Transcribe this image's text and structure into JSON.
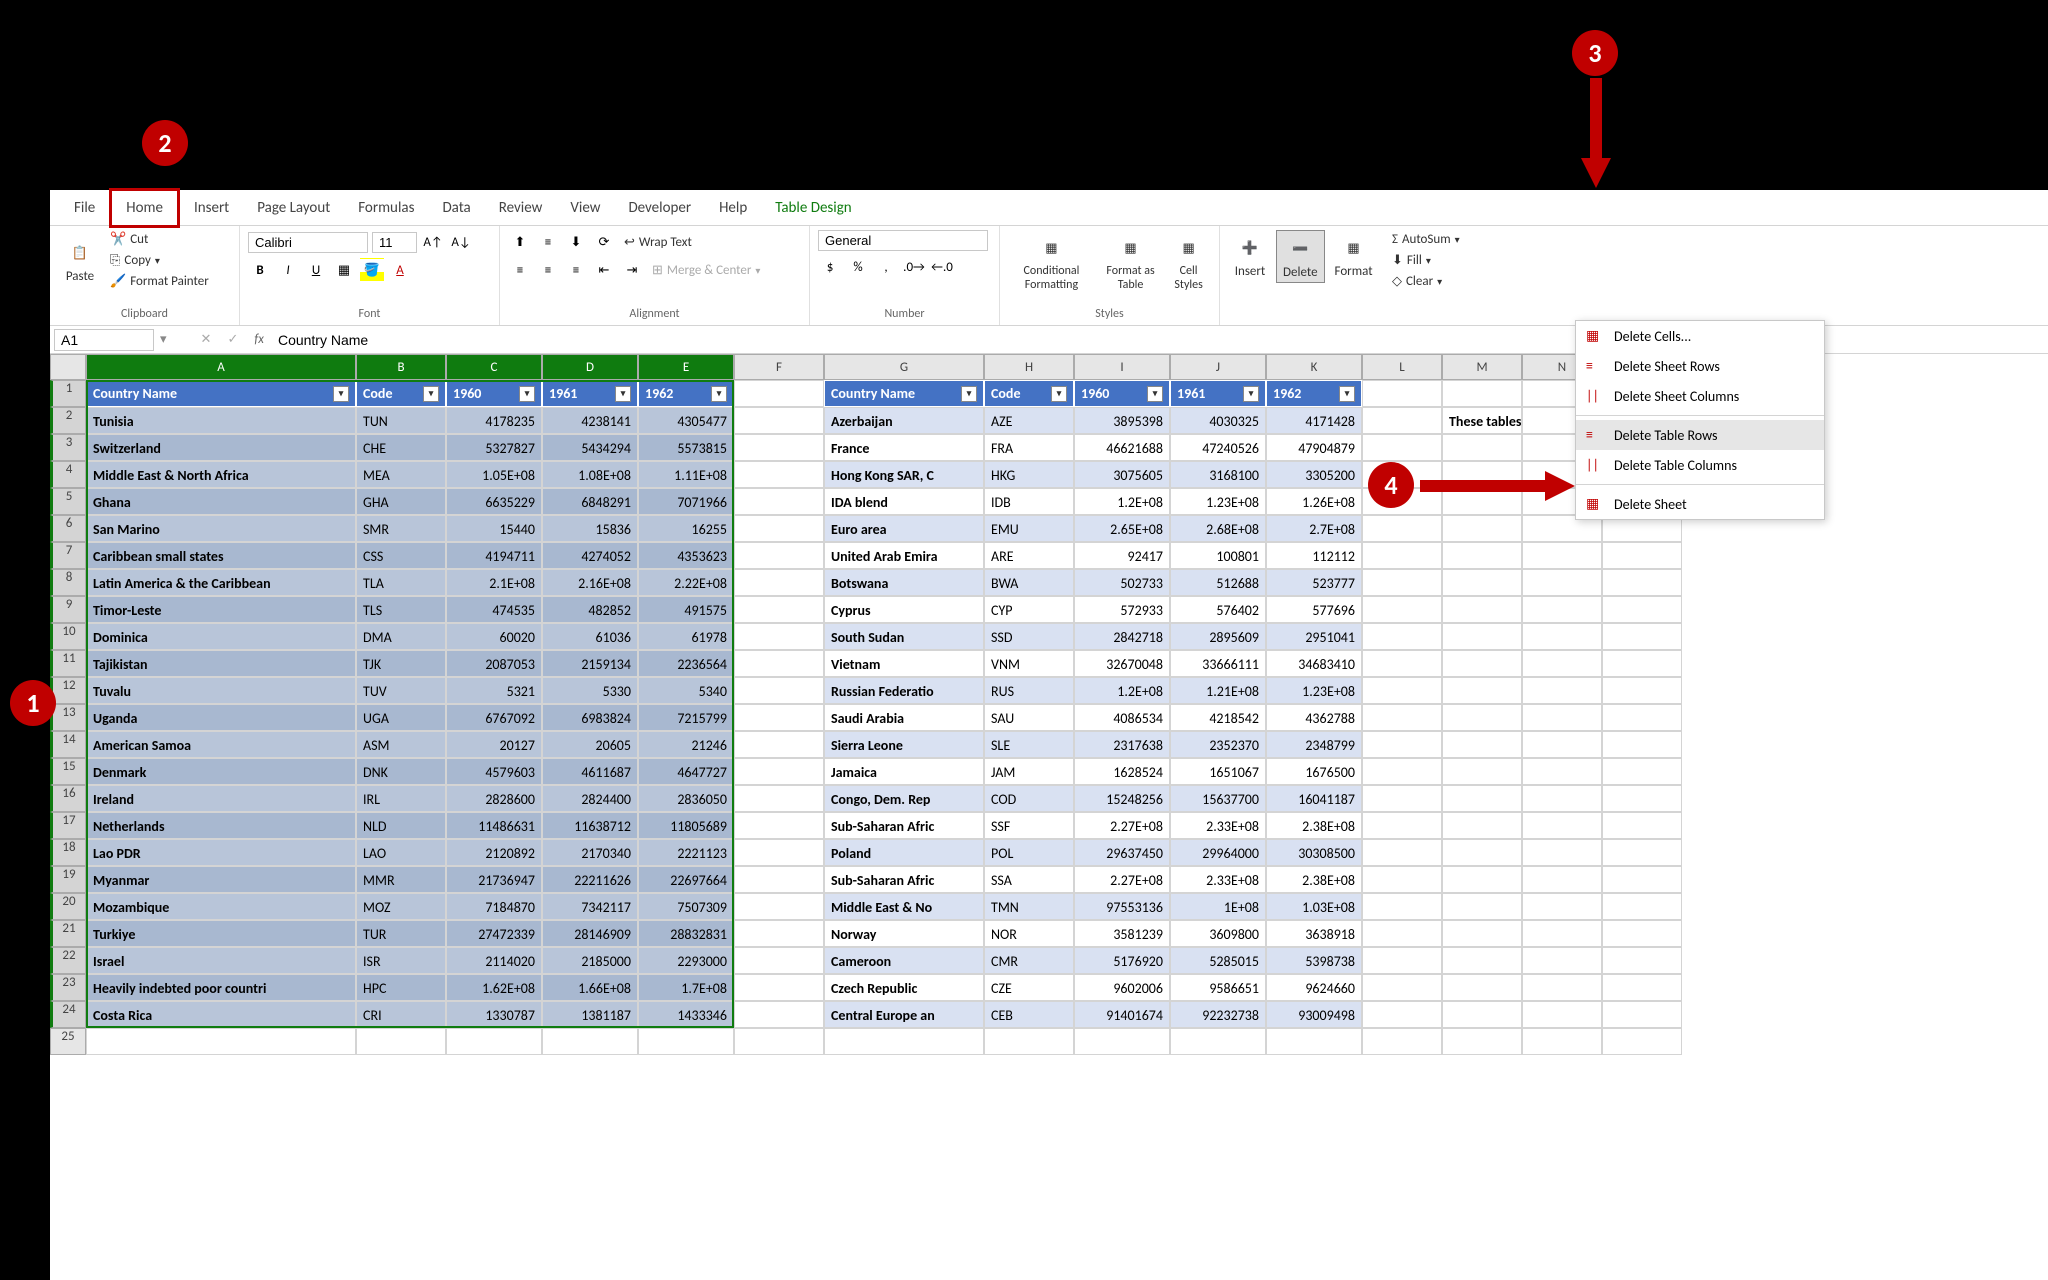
{
  "ribbon": {
    "tabs": [
      "File",
      "Home",
      "Insert",
      "Page Layout",
      "Formulas",
      "Data",
      "Review",
      "View",
      "Developer",
      "Help",
      "Table Design"
    ],
    "active_tab": "Home",
    "clipboard": {
      "paste": "Paste",
      "cut": "Cut",
      "copy": "Copy",
      "format_painter": "Format Painter",
      "label": "Clipboard"
    },
    "font": {
      "name": "Calibri",
      "size": "11",
      "label": "Font"
    },
    "alignment": {
      "wrap": "Wrap Text",
      "merge": "Merge & Center",
      "label": "Alignment"
    },
    "number": {
      "format": "General",
      "label": "Number"
    },
    "styles": {
      "conditional": "Conditional Formatting",
      "format_table": "Format as Table",
      "cell_styles": "Cell Styles",
      "label": "Styles"
    },
    "cells": {
      "insert": "Insert",
      "delete": "Delete",
      "format": "Format"
    },
    "editing": {
      "autosum": "AutoSum",
      "fill": "Fill",
      "clear": "Clear"
    }
  },
  "namebox": {
    "ref": "A1",
    "formula": "Country Name"
  },
  "columns": [
    "A",
    "B",
    "C",
    "D",
    "E",
    "F",
    "G",
    "H",
    "I",
    "J",
    "K",
    "L"
  ],
  "table1": {
    "headers": [
      "Country Name",
      "Code",
      "1960",
      "1961",
      "1962"
    ],
    "rows": [
      [
        "Tunisia",
        "TUN",
        "4178235",
        "4238141",
        "4305477"
      ],
      [
        "Switzerland",
        "CHE",
        "5327827",
        "5434294",
        "5573815"
      ],
      [
        "Middle East & North Africa",
        "MEA",
        "1.05E+08",
        "1.08E+08",
        "1.11E+08"
      ],
      [
        "Ghana",
        "GHA",
        "6635229",
        "6848291",
        "7071966"
      ],
      [
        "San Marino",
        "SMR",
        "15440",
        "15836",
        "16255"
      ],
      [
        "Caribbean small states",
        "CSS",
        "4194711",
        "4274052",
        "4353623"
      ],
      [
        "Latin America & the Caribbean",
        "TLA",
        "2.1E+08",
        "2.16E+08",
        "2.22E+08"
      ],
      [
        "Timor-Leste",
        "TLS",
        "474535",
        "482852",
        "491575"
      ],
      [
        "Dominica",
        "DMA",
        "60020",
        "61036",
        "61978"
      ],
      [
        "Tajikistan",
        "TJK",
        "2087053",
        "2159134",
        "2236564"
      ],
      [
        "Tuvalu",
        "TUV",
        "5321",
        "5330",
        "5340"
      ],
      [
        "Uganda",
        "UGA",
        "6767092",
        "6983824",
        "7215799"
      ],
      [
        "American Samoa",
        "ASM",
        "20127",
        "20605",
        "21246"
      ],
      [
        "Denmark",
        "DNK",
        "4579603",
        "4611687",
        "4647727"
      ],
      [
        "Ireland",
        "IRL",
        "2828600",
        "2824400",
        "2836050"
      ],
      [
        "Netherlands",
        "NLD",
        "11486631",
        "11638712",
        "11805689"
      ],
      [
        "Lao PDR",
        "LAO",
        "2120892",
        "2170340",
        "2221123"
      ],
      [
        "Myanmar",
        "MMR",
        "21736947",
        "22211626",
        "22697664"
      ],
      [
        "Mozambique",
        "MOZ",
        "7184870",
        "7342117",
        "7507309"
      ],
      [
        "Turkiye",
        "TUR",
        "27472339",
        "28146909",
        "28832831"
      ],
      [
        "Israel",
        "ISR",
        "2114020",
        "2185000",
        "2293000"
      ],
      [
        "Heavily indebted poor countri",
        "HPC",
        "1.62E+08",
        "1.66E+08",
        "1.7E+08"
      ],
      [
        "Costa Rica",
        "CRI",
        "1330787",
        "1381187",
        "1433346"
      ]
    ]
  },
  "table2": {
    "headers": [
      "Country Name",
      "Code",
      "1960",
      "1961",
      "1962"
    ],
    "rows": [
      [
        "Azerbaijan",
        "AZE",
        "3895398",
        "4030325",
        "4171428"
      ],
      [
        "France",
        "FRA",
        "46621688",
        "47240526",
        "47904879"
      ],
      [
        "Hong Kong SAR, C",
        "HKG",
        "3075605",
        "3168100",
        "3305200"
      ],
      [
        "IDA blend",
        "IDB",
        "1.2E+08",
        "1.23E+08",
        "1.26E+08"
      ],
      [
        "Euro area",
        "EMU",
        "2.65E+08",
        "2.68E+08",
        "2.7E+08"
      ],
      [
        "United Arab Emira",
        "ARE",
        "92417",
        "100801",
        "112112"
      ],
      [
        "Botswana",
        "BWA",
        "502733",
        "512688",
        "523777"
      ],
      [
        "Cyprus",
        "CYP",
        "572933",
        "576402",
        "577696"
      ],
      [
        "South Sudan",
        "SSD",
        "2842718",
        "2895609",
        "2951041"
      ],
      [
        "Vietnam",
        "VNM",
        "32670048",
        "33666111",
        "34683410"
      ],
      [
        "Russian Federatio",
        "RUS",
        "1.2E+08",
        "1.21E+08",
        "1.23E+08"
      ],
      [
        "Saudi Arabia",
        "SAU",
        "4086534",
        "4218542",
        "4362788"
      ],
      [
        "Sierra Leone",
        "SLE",
        "2317638",
        "2352370",
        "2348799"
      ],
      [
        "Jamaica",
        "JAM",
        "1628524",
        "1651067",
        "1676500"
      ],
      [
        "Congo, Dem. Rep",
        "COD",
        "15248256",
        "15637700",
        "16041187"
      ],
      [
        "Sub-Saharan Afric",
        "SSF",
        "2.27E+08",
        "2.33E+08",
        "2.38E+08"
      ],
      [
        "Poland",
        "POL",
        "29637450",
        "29964000",
        "30308500"
      ],
      [
        "Sub-Saharan Afric",
        "SSA",
        "2.27E+08",
        "2.33E+08",
        "2.38E+08"
      ],
      [
        "Middle East & No",
        "TMN",
        "97553136",
        "1E+08",
        "1.03E+08"
      ],
      [
        "Norway",
        "NOR",
        "3581239",
        "3609800",
        "3638918"
      ],
      [
        "Cameroon",
        "CMR",
        "5176920",
        "5285015",
        "5398738"
      ],
      [
        "Czech Republic",
        "CZE",
        "9602006",
        "9586651",
        "9624660"
      ],
      [
        "Central Europe an",
        "CEB",
        "91401674",
        "92232738",
        "93009498"
      ]
    ]
  },
  "note_text": "These tables sho",
  "delete_menu": {
    "items": [
      {
        "icon": "cells",
        "label": "Delete Cells..."
      },
      {
        "icon": "rows",
        "label": "Delete Sheet Rows"
      },
      {
        "icon": "cols",
        "label": "Delete Sheet Columns"
      },
      {
        "icon": "trows",
        "label": "Delete Table Rows"
      },
      {
        "icon": "tcols",
        "label": "Delete Table Columns"
      },
      {
        "icon": "sheet",
        "label": "Delete Sheet"
      }
    ]
  },
  "callouts": {
    "c1": "1",
    "c2": "2",
    "c3": "3",
    "c4": "4"
  }
}
